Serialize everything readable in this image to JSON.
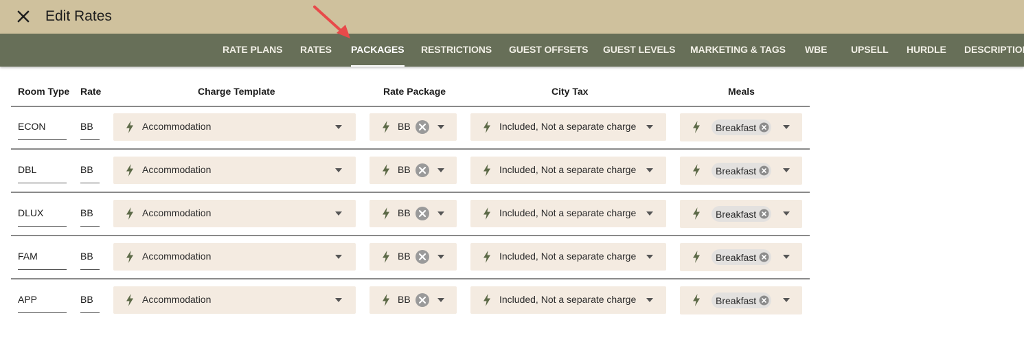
{
  "header": {
    "title": "Edit Rates",
    "close_icon": "close-icon",
    "background": "#cfc19d"
  },
  "tabs": [
    {
      "label": "RATE PLANS",
      "active": false
    },
    {
      "label": "RATES",
      "active": false
    },
    {
      "label": "PACKAGES",
      "active": true
    },
    {
      "label": "RESTRICTIONS",
      "active": false
    },
    {
      "label": "GUEST OFFSETS",
      "active": false
    },
    {
      "label": "GUEST LEVELS",
      "active": false
    },
    {
      "label": "MARKETING & TAGS",
      "active": false
    },
    {
      "label": "WBE",
      "active": false
    },
    {
      "label": "UPSELL",
      "active": false
    },
    {
      "label": "HURDLE",
      "active": false
    },
    {
      "label": "DESCRIPTION",
      "active": false
    }
  ],
  "table": {
    "columns": [
      "Room Type",
      "Rate",
      "Charge Template",
      "Rate Package",
      "City Tax",
      "Meals"
    ],
    "rows": [
      {
        "room_type": "ECON",
        "rate": "BB",
        "charge_template": "Accommodation",
        "rate_package": "BB",
        "city_tax": "Included, Not a separate charge",
        "meals": "Breakfast"
      },
      {
        "room_type": "DBL",
        "rate": "BB",
        "charge_template": "Accommodation",
        "rate_package": "BB",
        "city_tax": "Included, Not a separate charge",
        "meals": "Breakfast"
      },
      {
        "room_type": "DLUX",
        "rate": "BB",
        "charge_template": "Accommodation",
        "rate_package": "BB",
        "city_tax": "Included, Not a separate charge",
        "meals": "Breakfast"
      },
      {
        "room_type": "FAM",
        "rate": "BB",
        "charge_template": "Accommodation",
        "rate_package": "BB",
        "city_tax": "Included, Not a separate charge",
        "meals": "Breakfast"
      },
      {
        "room_type": "APP",
        "rate": "BB",
        "charge_template": "Accommodation",
        "rate_package": "BB",
        "city_tax": "Included, Not a separate charge",
        "meals": "Breakfast"
      }
    ]
  },
  "colors": {
    "header_bg": "#cfc19d",
    "tabbar_bg": "#676f58",
    "select_bg": "#f4ebe1",
    "bolt_icon": "#5d6a48",
    "annotation_arrow": "#e84a4a"
  },
  "icons": {
    "field_icon": "lightning-bolt-icon",
    "clear_icon": "clear-circle-icon",
    "dropdown_icon": "chevron-down-icon"
  }
}
